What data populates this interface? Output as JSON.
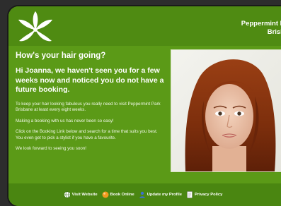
{
  "brand": {
    "line1": "Peppermint P",
    "line2": "Brisb"
  },
  "email": {
    "headline": "How's your hair going?",
    "intro": "Hi Joanna, we haven't seen you for a few weeks now and noticed you do not have a future booking.",
    "paragraphs": [
      "To keep your hair looking fabulous you really need to visit Peppermint Park Brisbane at least every eight weeks.",
      "Making a booking with us has never been so easy!",
      "Click on the Booking Link below and search for a time that suits you best.  You even get to pick a stylist if you have a favourite.",
      "We look forward to seeing you soon!"
    ]
  },
  "footer": {
    "links": [
      {
        "label": "Visit Website",
        "icon": "globe-icon"
      },
      {
        "label": "Book Online",
        "icon": "orange-ball-icon"
      },
      {
        "label": "Update my Profile",
        "icon": "person-icon"
      },
      {
        "label": "Privacy Policy",
        "icon": "document-icon"
      }
    ]
  },
  "colors": {
    "card_green": "#5b9a17",
    "header_green": "#4f8b12",
    "footer_green": "#4a8611",
    "background": "#2d2d2d"
  }
}
